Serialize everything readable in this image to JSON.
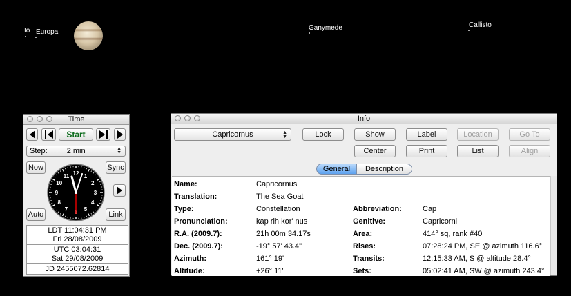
{
  "sky": {
    "moons": [
      {
        "name": "Io"
      },
      {
        "name": "Europa"
      },
      {
        "name": "Ganymede"
      },
      {
        "name": "Callisto"
      }
    ]
  },
  "time_window": {
    "title": "Time",
    "start_label": "Start",
    "step_label": "Step:",
    "step_value": "2 min",
    "now_label": "Now",
    "sync_label": "Sync",
    "auto_label": "Auto",
    "link_label": "Link",
    "clock_numbers": [
      "12",
      "1",
      "2",
      "3",
      "4",
      "5",
      "6",
      "7",
      "8",
      "9",
      "10",
      "11"
    ],
    "ldt_line1": "LDT 11:04:31 PM",
    "ldt_line2": "Fri 28/08/2009",
    "utc_line1": "UTC 03:04:31",
    "utc_line2": "Sat 29/08/2009",
    "jd": "JD 2455072.62814"
  },
  "info_window": {
    "title": "Info",
    "object_select": "Capricornus",
    "buttons": {
      "lock": "Lock",
      "show": "Show",
      "label": "Label",
      "location": "Location",
      "goto": "Go To",
      "center": "Center",
      "print": "Print",
      "list": "List",
      "align": "Align"
    },
    "tabs": {
      "general": "General",
      "description": "Description"
    },
    "left_rows": [
      {
        "label": "Name:",
        "value": "Capricornus"
      },
      {
        "label": "Translation:",
        "value": "The Sea Goat"
      },
      {
        "label": "Type:",
        "value": "Constellation"
      },
      {
        "label": "Pronunciation:",
        "value": "kap rih kor' nus"
      },
      {
        "label": "R.A. (2009.7):",
        "value": "21h 00m 34.17s"
      },
      {
        "label": "Dec. (2009.7):",
        "value": "-19° 57' 43.4\""
      },
      {
        "label": "Azimuth:",
        "value": "161° 19'"
      },
      {
        "label": "Altitude:",
        "value": "+26° 11'"
      }
    ],
    "right_rows": [
      {
        "label": "Abbreviation:",
        "value": "Cap"
      },
      {
        "label": "Genitive:",
        "value": "Capricorni"
      },
      {
        "label": "Area:",
        "value": "414° sq, rank #40"
      },
      {
        "label": "Rises:",
        "value": "07:28:24 PM, SE @ azimuth 116.6°"
      },
      {
        "label": "Transits:",
        "value": "12:15:33 AM, S @ altitude 28.4°"
      },
      {
        "label": "Sets:",
        "value": "05:02:41 AM, SW @ azimuth 243.4°"
      }
    ]
  }
}
